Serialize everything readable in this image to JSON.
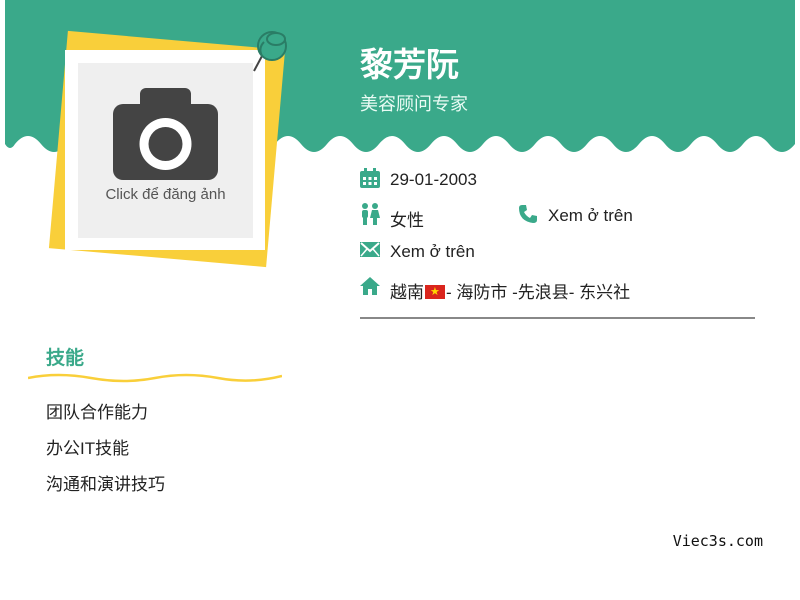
{
  "profile": {
    "name": "黎芳阮",
    "job_title": "美容顾问专家",
    "photo_label": "Click để đăng ảnh"
  },
  "info": {
    "birthday": "29-01-2003",
    "gender": "女性",
    "phone": "Xem ở trên",
    "email": "Xem ở trên",
    "address_country": "越南",
    "address_rest": "- 海防市 -先浪县- 东兴社"
  },
  "skills": {
    "title": "技能",
    "items": [
      "团队合作能力",
      "办公IT技能",
      "沟通和演讲技巧"
    ]
  },
  "footer": {
    "brand": "Viec3s.com"
  },
  "colors": {
    "accent": "#3aa98a",
    "note": "#f9cf3a"
  },
  "icons": [
    "calendar-icon",
    "gender-icon",
    "phone-icon",
    "mail-icon",
    "home-icon",
    "camera-icon",
    "pin-icon"
  ]
}
